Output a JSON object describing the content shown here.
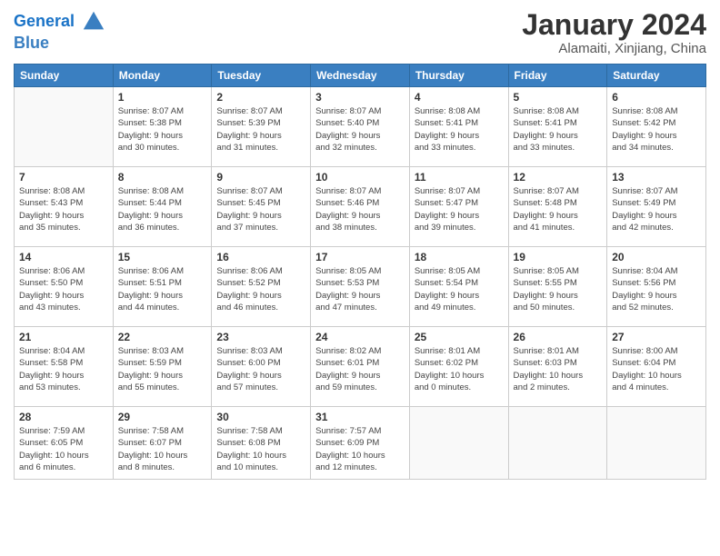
{
  "header": {
    "logo_line1": "General",
    "logo_line2": "Blue",
    "month_title": "January 2024",
    "location": "Alamaiti, Xinjiang, China"
  },
  "weekdays": [
    "Sunday",
    "Monday",
    "Tuesday",
    "Wednesday",
    "Thursday",
    "Friday",
    "Saturday"
  ],
  "weeks": [
    [
      {
        "day": "",
        "info": ""
      },
      {
        "day": "1",
        "info": "Sunrise: 8:07 AM\nSunset: 5:38 PM\nDaylight: 9 hours\nand 30 minutes."
      },
      {
        "day": "2",
        "info": "Sunrise: 8:07 AM\nSunset: 5:39 PM\nDaylight: 9 hours\nand 31 minutes."
      },
      {
        "day": "3",
        "info": "Sunrise: 8:07 AM\nSunset: 5:40 PM\nDaylight: 9 hours\nand 32 minutes."
      },
      {
        "day": "4",
        "info": "Sunrise: 8:08 AM\nSunset: 5:41 PM\nDaylight: 9 hours\nand 33 minutes."
      },
      {
        "day": "5",
        "info": "Sunrise: 8:08 AM\nSunset: 5:41 PM\nDaylight: 9 hours\nand 33 minutes."
      },
      {
        "day": "6",
        "info": "Sunrise: 8:08 AM\nSunset: 5:42 PM\nDaylight: 9 hours\nand 34 minutes."
      }
    ],
    [
      {
        "day": "7",
        "info": "Sunrise: 8:08 AM\nSunset: 5:43 PM\nDaylight: 9 hours\nand 35 minutes."
      },
      {
        "day": "8",
        "info": "Sunrise: 8:08 AM\nSunset: 5:44 PM\nDaylight: 9 hours\nand 36 minutes."
      },
      {
        "day": "9",
        "info": "Sunrise: 8:07 AM\nSunset: 5:45 PM\nDaylight: 9 hours\nand 37 minutes."
      },
      {
        "day": "10",
        "info": "Sunrise: 8:07 AM\nSunset: 5:46 PM\nDaylight: 9 hours\nand 38 minutes."
      },
      {
        "day": "11",
        "info": "Sunrise: 8:07 AM\nSunset: 5:47 PM\nDaylight: 9 hours\nand 39 minutes."
      },
      {
        "day": "12",
        "info": "Sunrise: 8:07 AM\nSunset: 5:48 PM\nDaylight: 9 hours\nand 41 minutes."
      },
      {
        "day": "13",
        "info": "Sunrise: 8:07 AM\nSunset: 5:49 PM\nDaylight: 9 hours\nand 42 minutes."
      }
    ],
    [
      {
        "day": "14",
        "info": "Sunrise: 8:06 AM\nSunset: 5:50 PM\nDaylight: 9 hours\nand 43 minutes."
      },
      {
        "day": "15",
        "info": "Sunrise: 8:06 AM\nSunset: 5:51 PM\nDaylight: 9 hours\nand 44 minutes."
      },
      {
        "day": "16",
        "info": "Sunrise: 8:06 AM\nSunset: 5:52 PM\nDaylight: 9 hours\nand 46 minutes."
      },
      {
        "day": "17",
        "info": "Sunrise: 8:05 AM\nSunset: 5:53 PM\nDaylight: 9 hours\nand 47 minutes."
      },
      {
        "day": "18",
        "info": "Sunrise: 8:05 AM\nSunset: 5:54 PM\nDaylight: 9 hours\nand 49 minutes."
      },
      {
        "day": "19",
        "info": "Sunrise: 8:05 AM\nSunset: 5:55 PM\nDaylight: 9 hours\nand 50 minutes."
      },
      {
        "day": "20",
        "info": "Sunrise: 8:04 AM\nSunset: 5:56 PM\nDaylight: 9 hours\nand 52 minutes."
      }
    ],
    [
      {
        "day": "21",
        "info": "Sunrise: 8:04 AM\nSunset: 5:58 PM\nDaylight: 9 hours\nand 53 minutes."
      },
      {
        "day": "22",
        "info": "Sunrise: 8:03 AM\nSunset: 5:59 PM\nDaylight: 9 hours\nand 55 minutes."
      },
      {
        "day": "23",
        "info": "Sunrise: 8:03 AM\nSunset: 6:00 PM\nDaylight: 9 hours\nand 57 minutes."
      },
      {
        "day": "24",
        "info": "Sunrise: 8:02 AM\nSunset: 6:01 PM\nDaylight: 9 hours\nand 59 minutes."
      },
      {
        "day": "25",
        "info": "Sunrise: 8:01 AM\nSunset: 6:02 PM\nDaylight: 10 hours\nand 0 minutes."
      },
      {
        "day": "26",
        "info": "Sunrise: 8:01 AM\nSunset: 6:03 PM\nDaylight: 10 hours\nand 2 minutes."
      },
      {
        "day": "27",
        "info": "Sunrise: 8:00 AM\nSunset: 6:04 PM\nDaylight: 10 hours\nand 4 minutes."
      }
    ],
    [
      {
        "day": "28",
        "info": "Sunrise: 7:59 AM\nSunset: 6:05 PM\nDaylight: 10 hours\nand 6 minutes."
      },
      {
        "day": "29",
        "info": "Sunrise: 7:58 AM\nSunset: 6:07 PM\nDaylight: 10 hours\nand 8 minutes."
      },
      {
        "day": "30",
        "info": "Sunrise: 7:58 AM\nSunset: 6:08 PM\nDaylight: 10 hours\nand 10 minutes."
      },
      {
        "day": "31",
        "info": "Sunrise: 7:57 AM\nSunset: 6:09 PM\nDaylight: 10 hours\nand 12 minutes."
      },
      {
        "day": "",
        "info": ""
      },
      {
        "day": "",
        "info": ""
      },
      {
        "day": "",
        "info": ""
      }
    ]
  ]
}
